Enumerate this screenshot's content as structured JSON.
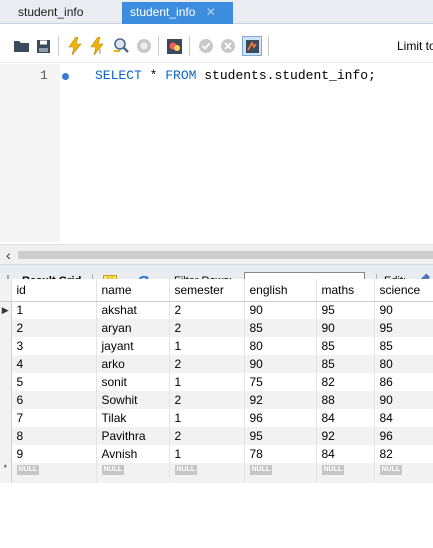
{
  "tabs": [
    {
      "label": "student_info",
      "active": false
    },
    {
      "label": "student_info",
      "active": true
    }
  ],
  "toolbar": {
    "icons": [
      "open-folder-icon",
      "save-icon",
      "execute-lightning-icon",
      "execute-current-lightning-icon",
      "explain-magnifier-icon",
      "stop-icon",
      "toggle-result-icon",
      "commit-check-icon",
      "rollback-x-icon",
      "autocommit-icon"
    ],
    "limit_label": "Limit to"
  },
  "editor": {
    "line_number": "1",
    "sql": {
      "kw1": "SELECT",
      "rest1": " * ",
      "kw2": "FROM",
      "rest2": " students.student_info;"
    }
  },
  "result_toolbar": {
    "result_grid_label": "Result Grid",
    "filter_rows_label": "Filter Rows:",
    "filter_value": "",
    "edit_label": "Edit:"
  },
  "grid": {
    "columns": [
      "id",
      "name",
      "semester",
      "english",
      "maths",
      "science"
    ],
    "rows": [
      [
        "1",
        "akshat",
        "2",
        "90",
        "95",
        "90"
      ],
      [
        "2",
        "aryan",
        "2",
        "85",
        "90",
        "95"
      ],
      [
        "3",
        "jayant",
        "1",
        "80",
        "85",
        "85"
      ],
      [
        "4",
        "arko",
        "2",
        "90",
        "85",
        "80"
      ],
      [
        "5",
        "sonit",
        "1",
        "75",
        "82",
        "86"
      ],
      [
        "6",
        "Sowhit",
        "2",
        "92",
        "88",
        "90"
      ],
      [
        "7",
        "Tilak",
        "1",
        "96",
        "84",
        "84"
      ],
      [
        "8",
        "Pavithra",
        "2",
        "95",
        "92",
        "96"
      ],
      [
        "9",
        "Avnish",
        "1",
        "78",
        "84",
        "82"
      ]
    ],
    "null_label": "NULL",
    "current_row_marker": "▶",
    "new_row_marker": "*"
  },
  "colors": {
    "active_tab": "#3c8dde",
    "keyword": "#0a64c8",
    "tab_bar": "#e9edf2"
  }
}
